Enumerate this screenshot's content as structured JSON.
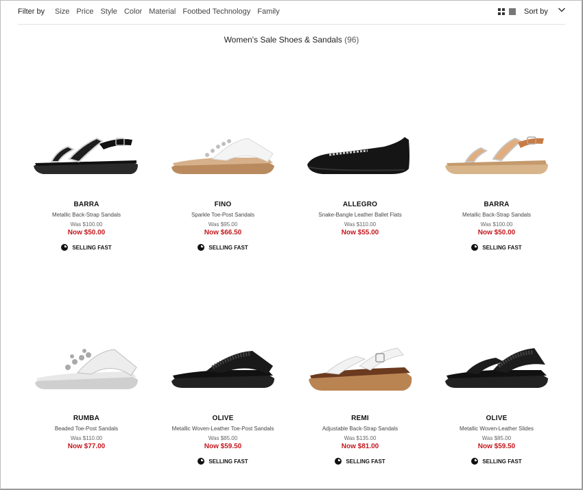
{
  "filter_bar": {
    "label": "Filter by",
    "filters": [
      "Size",
      "Price",
      "Style",
      "Color",
      "Material",
      "Footbed Technology",
      "Family"
    ],
    "sort_label": "Sort by"
  },
  "heading": {
    "title": "Women's Sale Shoes & Sandals",
    "count": "(96)"
  },
  "colors": {
    "sale_price": "#c4161c",
    "text": "#222222"
  },
  "products": [
    {
      "name": "BARRA",
      "description": "Metallic Back-Strap Sandals",
      "was": "Was $100.00",
      "now": "Now $50.00",
      "badge": "SELLING FAST",
      "image_icon": "black-back-strap-sandal"
    },
    {
      "name": "FINO",
      "description": "Sparkle Toe-Post Sandals",
      "was": "Was $95.00",
      "now": "Now $66.50",
      "badge": "SELLING FAST",
      "image_icon": "white-toe-post-sandal"
    },
    {
      "name": "ALLEGRO",
      "description": "Snake-Bangle Leather Ballet Flats",
      "was": "Was $110.00",
      "now": "Now $55.00",
      "badge": "",
      "image_icon": "black-ballet-flat"
    },
    {
      "name": "BARRA",
      "description": "Metallic Back-Strap Sandals",
      "was": "Was $100.00",
      "now": "Now $50.00",
      "badge": "SELLING FAST",
      "image_icon": "tan-back-strap-sandal"
    },
    {
      "name": "RUMBA",
      "description": "Beaded Toe-Post Sandals",
      "was": "Was $110.00",
      "now": "Now $77.00",
      "badge": "",
      "image_icon": "silver-beaded-sandal"
    },
    {
      "name": "OLIVE",
      "description": "Metallic Woven-Leather Toe-Post Sandals",
      "was": "Was $85.00",
      "now": "Now $59.50",
      "badge": "SELLING FAST",
      "image_icon": "black-woven-toe-post"
    },
    {
      "name": "REMI",
      "description": "Adjustable Back-Strap Sandals",
      "was": "Was $135.00",
      "now": "Now $81.00",
      "badge": "SELLING FAST",
      "image_icon": "white-cork-sandal"
    },
    {
      "name": "OLIVE",
      "description": "Metallic Woven-Leather Slides",
      "was": "Was $85.00",
      "now": "Now $59.50",
      "badge": "SELLING FAST",
      "image_icon": "black-woven-slide"
    }
  ]
}
